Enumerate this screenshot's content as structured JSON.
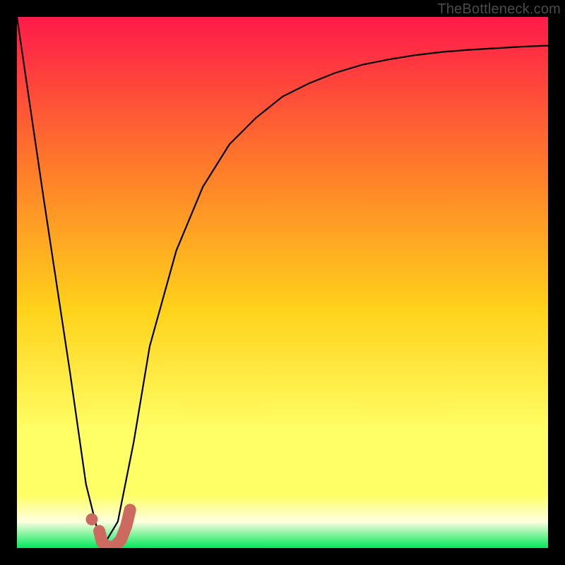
{
  "watermark": "TheBottleneck.com",
  "colors": {
    "black": "#000000",
    "curve_stroke": "#000000",
    "marker_fill": "#cc6a5f",
    "marker_stroke": "#cc6a5f",
    "gradient_top": "#ff1a4a",
    "gradient_mid1": "#ff7a2a",
    "gradient_mid2": "#ffd21a",
    "gradient_mid3": "#ffff66",
    "gradient_pale": "#ffffe0",
    "gradient_green": "#00e85a"
  },
  "chart_data": {
    "type": "line",
    "title": "",
    "xlabel": "",
    "ylabel": "",
    "x": [
      0,
      5,
      10,
      13,
      16,
      19,
      22,
      25,
      30,
      35,
      40,
      45,
      50,
      55,
      60,
      65,
      70,
      75,
      80,
      85,
      90,
      95,
      100
    ],
    "values": [
      100,
      66,
      33,
      12,
      0,
      5,
      20,
      38,
      56,
      68,
      76,
      81,
      85,
      87.5,
      89.5,
      91,
      92,
      92.8,
      93.4,
      93.8,
      94.1,
      94.4,
      94.6
    ],
    "xlim": [
      0,
      100
    ],
    "ylim": [
      0,
      100
    ],
    "markers": {
      "path": [
        {
          "x": 15.5,
          "y": 3.2
        },
        {
          "x": 16.0,
          "y": 1.2
        },
        {
          "x": 17.0,
          "y": 0.2
        },
        {
          "x": 18.3,
          "y": 0.2
        },
        {
          "x": 19.6,
          "y": 1.6
        },
        {
          "x": 20.6,
          "y": 4.2
        },
        {
          "x": 21.3,
          "y": 7.2
        }
      ],
      "dot": {
        "x": 14.1,
        "y": 5.4
      }
    }
  }
}
